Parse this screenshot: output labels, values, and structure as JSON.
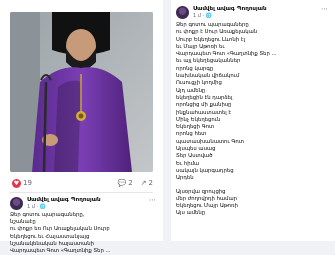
{
  "left_post": {
    "reactions": {
      "count": "19",
      "comments": "2",
      "shares": "2"
    },
    "author": "Սամվել ավագ Պողոսյան",
    "meta": "1 մ · 🌐",
    "text": "Ձեր գոտու պարագաները,\nնշանաէը\nու փոքր եռ Ուր Առաքելական Սուրբ\nԵկեղեցու եւ Հայաստանյայց\nնշանակենական հայաստանի\nՎարդապետ Գոտ «Գաղտնիք Տեր ..."
  },
  "right_post": {
    "author": "Սամվել ավագ Պողոսյան",
    "meta": "1 մ · 🌐",
    "text": "Ձեր գոտու պարագաները\nու փոքր է Սուր Առաքելական\nՍուրբ Եկեղեցու Լևոնի էլ\nեւ Մայր Աթոռի եւ\nՎարդապետ Գոտ «Գաղտնիք Տեր ...\nեւ այլ եկեղեցականներ\nորոնց կարգը\nնախնական վիճակում\nՈւսուցչի կողմից\nԱյդ ամենը\nեկեղեցին էն դարձել\nորոնցից մի քանիսը\nինքնահաստատել է\nՄինչ Եկեղեցուն\nԵկեղեցի Գոտ\nորոնց հետ\nպատասխանատու Գոտ\nԱյսպես ասաց\nՏեր Աստված\nԵւ հիմա\nսակայն կարգադրեց\nԱրդեն",
    "text2": "Այսօրվա զրույցից\nմեր ժողովրդի համար\nԵկեղեցու Մայր Աթոռի\nԱյս ամենը"
  }
}
